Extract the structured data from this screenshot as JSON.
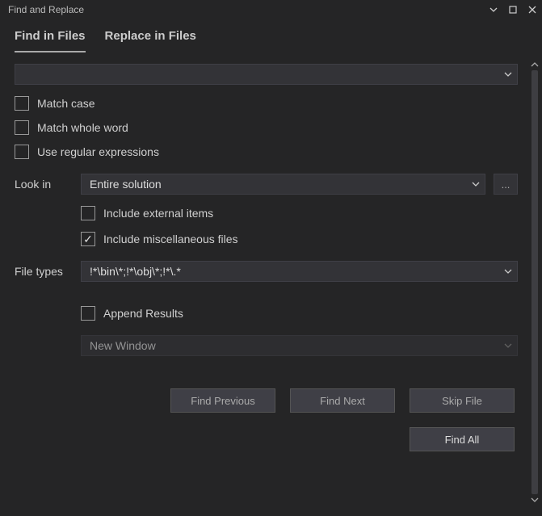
{
  "window": {
    "title": "Find and Replace"
  },
  "tabs": {
    "find": "Find in Files",
    "replace": "Replace in Files"
  },
  "search": {
    "value": ""
  },
  "options": {
    "match_case": "Match case",
    "match_whole_word": "Match whole word",
    "use_regex": "Use regular expressions"
  },
  "lookin": {
    "label": "Look in",
    "value": "Entire solution",
    "browse": "...",
    "include_external": "Include external items",
    "include_misc": "Include miscellaneous files"
  },
  "filetypes": {
    "label": "File types",
    "value": "!*\\bin\\*;!*\\obj\\*;!*\\.*"
  },
  "results": {
    "append": "Append Results",
    "window": "New Window"
  },
  "buttons": {
    "find_previous": "Find Previous",
    "find_next": "Find Next",
    "skip_file": "Skip File",
    "find_all": "Find All"
  }
}
